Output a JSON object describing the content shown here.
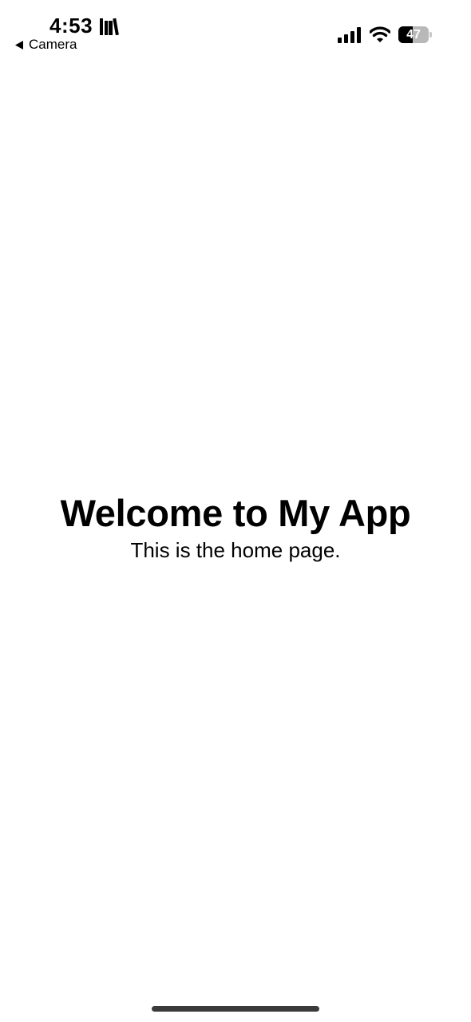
{
  "status_bar": {
    "time": "4:53",
    "back_label": "Camera",
    "battery_level": "47",
    "battery_fraction": 0.47,
    "icons": [
      "library-icon",
      "back-arrow-icon",
      "signal-icon",
      "wifi-icon",
      "battery-icon"
    ]
  },
  "main": {
    "title": "Welcome to My App",
    "subtitle": "This is the home page."
  }
}
